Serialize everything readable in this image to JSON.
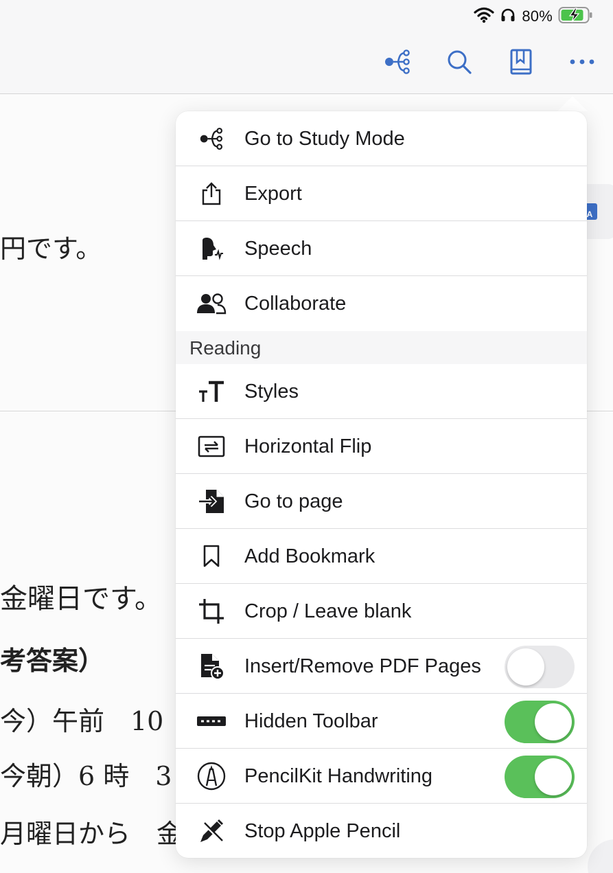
{
  "status_bar": {
    "battery_percent": "80%",
    "icons": [
      "wifi-icon",
      "headphones-icon",
      "battery-charging-icon"
    ]
  },
  "toolbar": {
    "icons": [
      "study-mode-icon",
      "search-icon",
      "bookmark-book-icon",
      "more-icon"
    ],
    "accent_color": "#3d6fc6"
  },
  "document": {
    "lines": [
      "円です。",
      "金曜日です。",
      "考答案）",
      "今）午前　10",
      "今朝）6 時　3",
      "月曜日から　金"
    ]
  },
  "menu": {
    "items_top": [
      {
        "label": "Go to Study Mode",
        "icon": "study-mode-icon"
      },
      {
        "label": "Export",
        "icon": "share-icon"
      },
      {
        "label": "Speech",
        "icon": "speech-icon"
      },
      {
        "label": "Collaborate",
        "icon": "people-icon"
      }
    ],
    "section_reading": "Reading",
    "items_reading": [
      {
        "label": "Styles",
        "icon": "text-size-icon"
      },
      {
        "label": "Horizontal Flip",
        "icon": "flip-icon"
      },
      {
        "label": "Go to page",
        "icon": "goto-page-icon"
      },
      {
        "label": "Add Bookmark",
        "icon": "bookmark-icon"
      },
      {
        "label": "Crop / Leave blank",
        "icon": "crop-icon"
      },
      {
        "label": "Insert/Remove PDF Pages",
        "icon": "file-plus-icon",
        "toggle": false
      },
      {
        "label": "Hidden Toolbar",
        "icon": "toolbar-icon",
        "toggle": true
      },
      {
        "label": "PencilKit Handwriting",
        "icon": "pencil-circle-icon",
        "toggle": true
      },
      {
        "label": "Stop Apple Pencil",
        "icon": "pencil-off-icon"
      }
    ],
    "toggle_on_color": "#5ac05a",
    "toggle_off_color": "#e9e9eb"
  }
}
